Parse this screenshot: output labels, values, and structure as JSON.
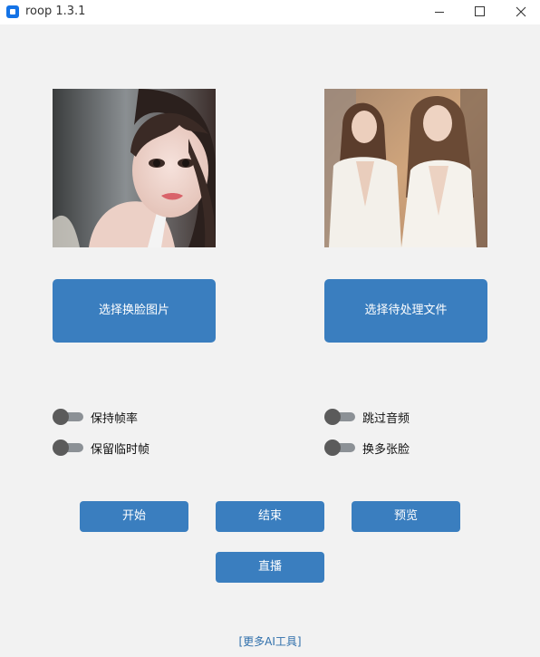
{
  "window": {
    "title": "roop 1.3.1",
    "accent": "#1473e6"
  },
  "buttons": {
    "select_face": "选择换脸图片",
    "select_target": "选择待处理文件",
    "start": "开始",
    "stop": "结束",
    "preview": "预览",
    "live": "直播"
  },
  "options": {
    "keep_fps": "保持帧率",
    "skip_audio": "跳过音频",
    "keep_frames": "保留临时帧",
    "many_faces": "换多张脸"
  },
  "footer": {
    "more_tools": "[更多AI工具]"
  },
  "colors": {
    "button": "#3a7ebf",
    "background": "#f2f2f2",
    "switch_off": "#5b5b5b"
  }
}
